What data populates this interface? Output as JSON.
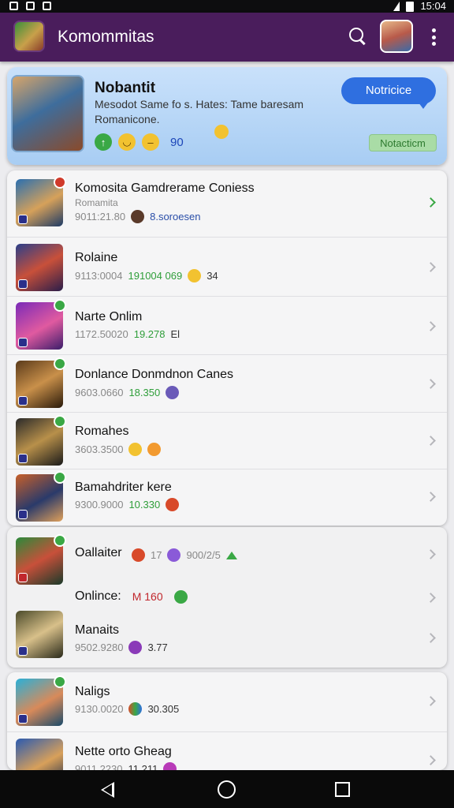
{
  "status_bar": {
    "time": "15:04"
  },
  "app_bar": {
    "title": "Komommitas"
  },
  "profile": {
    "name": "Nobantit",
    "status": "Mesodot Same fo s. Hates: Tame baresam Romanicone.",
    "stat_value": "90",
    "notify_label": "Notricice",
    "badge_label": "Notacticm"
  },
  "list_a": [
    {
      "title": "Komosita Gamdrerame Coniess",
      "sub": "Romamita",
      "meta_time": "9011:21.80",
      "meta_extra": "8.soroesen",
      "extra_color": "blue"
    },
    {
      "title": "Rolaine",
      "meta_time": "9113:0004",
      "meta_value": "191004 069",
      "meta_count": "34"
    },
    {
      "title": "Narte Onlim",
      "meta_time": "1172.50020",
      "meta_value": "19.278",
      "meta_count": "El"
    },
    {
      "title": "Donlance Donmdnon Canes",
      "meta_time": "9603.0660",
      "meta_value": "18.350"
    },
    {
      "title": "Romahes",
      "meta_time": "3603.3500"
    },
    {
      "title": "Bamahdriter kere",
      "meta_time": "9300.9000",
      "meta_value": "10.330"
    }
  ],
  "list_b": [
    {
      "title": "Oallaiter",
      "meta_count": "17",
      "meta_extra": "900/2/5"
    },
    {
      "title": "Onlince:",
      "meta_value": "M 160"
    },
    {
      "title": "Manaits",
      "meta_time": "9502.9280",
      "meta_count": "3.77"
    }
  ],
  "list_c": [
    {
      "title": "Naligs",
      "meta_time": "9130.0020",
      "meta_count": "30.305"
    },
    {
      "title": "Nette orto Gheag",
      "meta_time": "9011.2230",
      "meta_count": "11.211"
    }
  ],
  "colors": {
    "app_bar": "#4a1d5c",
    "accent_green": "#3aa845",
    "accent_blue": "#2f6fe0"
  }
}
